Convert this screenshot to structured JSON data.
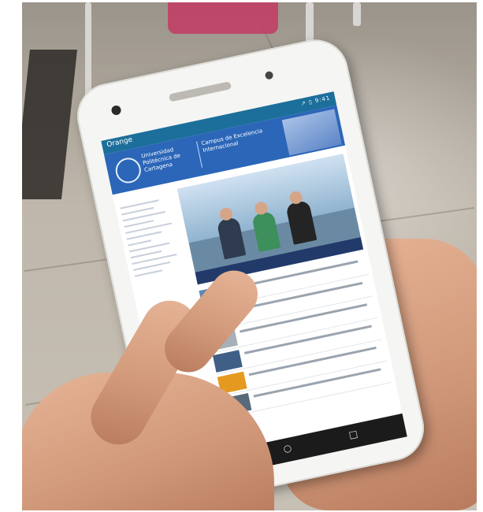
{
  "photo": {
    "description_free": true
  },
  "phone_screen": {
    "carrier": "Orange",
    "status_icons": "↗ ▯ 9:41",
    "university_name": "Universidad Politécnica de Cartagena",
    "campus_label": "Campus de Excelencia Internacional"
  },
  "icons": {
    "back": "back-icon",
    "home": "home-icon",
    "recent": "recent-apps-icon"
  },
  "colors": {
    "statusbar": "#1d6f9b",
    "banner": "#2b66b8",
    "skin": "#d29a7b",
    "phone": "#f5f5f3"
  }
}
